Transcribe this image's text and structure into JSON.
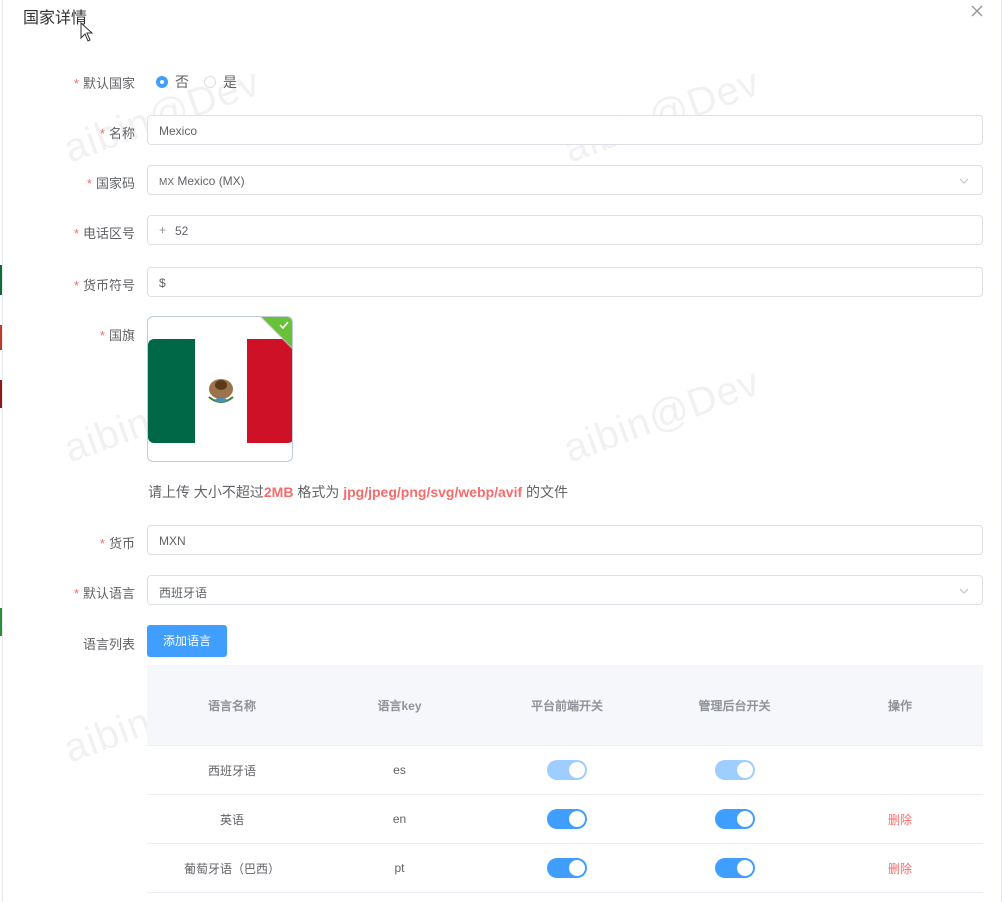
{
  "dialog": {
    "title": "国家详情"
  },
  "form": {
    "default_country": {
      "label": "默认国家",
      "options": [
        "否",
        "是"
      ],
      "selected": "否"
    },
    "name": {
      "label": "名称",
      "value": "Mexico"
    },
    "country_code": {
      "label": "国家码",
      "prefix": "MX",
      "value": "Mexico (MX)"
    },
    "phone_code": {
      "label": "电话区号",
      "prefix": "+",
      "value": "52"
    },
    "currency_symbol": {
      "label": "货币符号",
      "value": "$"
    },
    "flag": {
      "label": "国旗",
      "tip_prefix": "请上传 大小不超过",
      "tip_size": "2MB",
      "tip_mid": " 格式为 ",
      "tip_formats": "jpg/jpeg/png/svg/webp/avif",
      "tip_suffix": " 的文件"
    },
    "currency": {
      "label": "货币",
      "value": "MXN"
    },
    "default_language": {
      "label": "默认语言",
      "value": "西班牙语"
    },
    "language_list": {
      "label": "语言列表",
      "add_button": "添加语言"
    }
  },
  "table": {
    "headers": [
      "语言名称",
      "语言key",
      "平台前端开关",
      "管理后台开关",
      "操作"
    ],
    "rows": [
      {
        "name": "西班牙语",
        "key": "es",
        "frontend": true,
        "admin": true,
        "disabled": true,
        "action": ""
      },
      {
        "name": "英语",
        "key": "en",
        "frontend": true,
        "admin": true,
        "disabled": false,
        "action": "删除"
      },
      {
        "name": "葡萄牙语（巴西）",
        "key": "pt",
        "frontend": true,
        "admin": true,
        "disabled": false,
        "action": "删除"
      }
    ]
  },
  "watermark": "aibin@Dev",
  "colors": {
    "primary": "#409eff",
    "danger": "#f56c6c",
    "success": "#67c23a"
  }
}
